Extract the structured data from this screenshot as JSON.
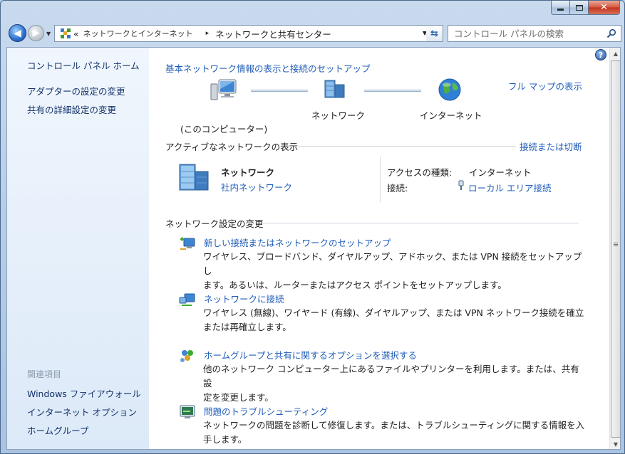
{
  "window": {
    "controls": {
      "minimize": "minimize",
      "maximize": "maximize",
      "close": "✕"
    }
  },
  "nav": {
    "address": {
      "overflow": "«",
      "crumbs": [
        "ネットワークとインターネット",
        "ネットワークと共有センター"
      ],
      "separator": "▸"
    },
    "search": {
      "placeholder": "コントロール パネルの検索"
    }
  },
  "sidebar": {
    "home": "コントロール パネル ホーム",
    "links": [
      "アダプターの設定の変更",
      "共有の詳細設定の変更"
    ],
    "related_header": "関連項目",
    "related": [
      "Windows ファイアウォール",
      "インターネット オプション",
      "ホームグループ"
    ]
  },
  "main": {
    "title": "基本ネットワーク情報の表示と接続のセットアップ",
    "full_map": "フル マップの表示",
    "map": {
      "computer": "(このコンピューター)",
      "network": "ネットワーク",
      "internet": "インターネット"
    },
    "active": {
      "title": "アクティブなネットワークの表示",
      "connect_link": "接続または切断",
      "network_name": "ネットワーク",
      "network_type": "社内ネットワーク",
      "access_label": "アクセスの種類:",
      "access_value": "インターネット",
      "conn_label": "接続:",
      "conn_value": "ローカル エリア接続"
    },
    "change": {
      "title": "ネットワーク設定の変更",
      "tasks": [
        {
          "link": "新しい接続またはネットワークのセットアップ",
          "desc1": "ワイヤレス、ブロードバンド、ダイヤルアップ、アドホック、または VPN 接続をセットアップし",
          "desc2": "ます。あるいは、ルーターまたはアクセス ポイントをセットアップします。"
        },
        {
          "link": "ネットワークに接続",
          "desc1": "ワイヤレス (無線)、ワイヤード (有線)、ダイヤルアップ、または VPN ネットワーク接続を確立",
          "desc2": "または再確立します。"
        },
        {
          "link": "ホームグループと共有に関するオプションを選択する",
          "desc1": "他のネットワーク コンピューター上にあるファイルやプリンターを利用します。または、共有設",
          "desc2": "定を変更します。"
        },
        {
          "link": "問題のトラブルシューティング",
          "desc1": "ネットワークの問題を診断して修復します。または、トラブルシューティングに関する情報を入",
          "desc2": "手します。"
        }
      ]
    }
  },
  "help": "?"
}
